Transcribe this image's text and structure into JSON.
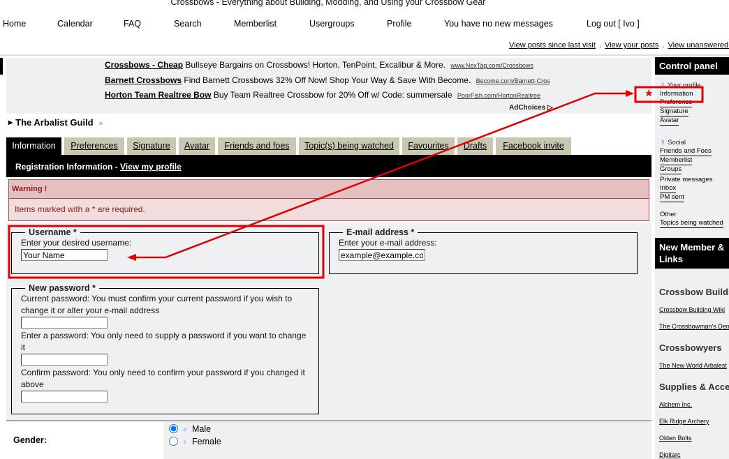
{
  "header": {
    "site_title": "Crossbows - Everything about Building, Modding, and Using your Crossbow Gear",
    "nav": [
      "Home",
      "Calendar",
      "FAQ",
      "Search",
      "Memberlist",
      "Usergroups",
      "Profile",
      "You have no new messages",
      "Log out [ Ivo ]"
    ],
    "quick_links": [
      "View posts since last visit",
      "View your posts",
      "View unanswered posts"
    ]
  },
  "ads": {
    "items": [
      {
        "title": "Crossbows - Cheap",
        "text": "Bullseye Bargains on Crossbows! Horton, TenPoint, Excalibur & More.",
        "url": "www.NexTag.com/Crossbows"
      },
      {
        "title": "Barnett Crossbows",
        "text": "Find Barnett Crossbows 32% Off Now! Shop Your Way & Save With Become.",
        "url": "Become.com/Barnett-Cros"
      },
      {
        "title": "Horton Team Realtree Bow",
        "text": "Buy Team Realtree Crossbow for 20% Off w/ Code: summersale",
        "url": "PoorFish.com/HortonRealtree"
      }
    ],
    "adchoices": "AdChoices"
  },
  "breadcrumb": {
    "forum": "The Arbalist Guild",
    "sep": ">"
  },
  "tabs": [
    "Information",
    "Preferences",
    "Signature",
    "Avatar",
    "Friends and foes",
    "Topic(s) being watched",
    "Favourites",
    "Drafts",
    "Facebook invite"
  ],
  "active_tab": "Information",
  "section": {
    "title": "Registration Information - ",
    "link": "View my profile"
  },
  "warning": {
    "title": "Warning !",
    "message": "Items marked with a * are required."
  },
  "form": {
    "username": {
      "legend": "Username *",
      "label": "Enter your desired username:",
      "value": "Your Name"
    },
    "email": {
      "legend": "E-mail address *",
      "label": "Enter your e-mail address:",
      "value": "example@example.com"
    },
    "password": {
      "legend": "New password *",
      "current_label": "Current password: You must confirm your current password if you wish to change it or alter your e-mail address",
      "new_label": "Enter a password: You only need to supply a password if you want to change it",
      "confirm_label": "Confirm password: You only need to confirm your password if you changed it above",
      "current_value": "",
      "new_value": "",
      "confirm_value": ""
    },
    "gender": {
      "label": "Gender:",
      "options": [
        "Male",
        "Female"
      ],
      "selected": "Male"
    }
  },
  "sidebar": {
    "control_panel": {
      "title": "Control panel",
      "profile_group": "Your profile",
      "profile_items": [
        "Information",
        "Preference",
        "Signature",
        "Avatar"
      ],
      "social_group": "Social",
      "social_items": [
        "Friends and Foes",
        "Memberlist",
        "Groups"
      ],
      "pm_group": "Private messages",
      "pm_items": [
        "Inbox",
        "PM sent"
      ],
      "other_group": "Other",
      "other_items": [
        "Topics being watched"
      ]
    },
    "links": {
      "title": "New Member & Links",
      "categories": [
        {
          "name": "Crossbow Building",
          "items": [
            "Crossbow Building Wiki",
            "The Crossbowman's Den"
          ]
        },
        {
          "name": "Crossbowyers",
          "items": [
            "The New World Arbalest"
          ]
        },
        {
          "name": "Supplies & Accessories",
          "items": [
            "Alchem Inc.",
            "Elk Ridge Archery",
            "Olden Bolts",
            "Digitarc"
          ]
        }
      ]
    }
  },
  "annotation": {
    "marker": "*",
    "color": "#e00000"
  }
}
